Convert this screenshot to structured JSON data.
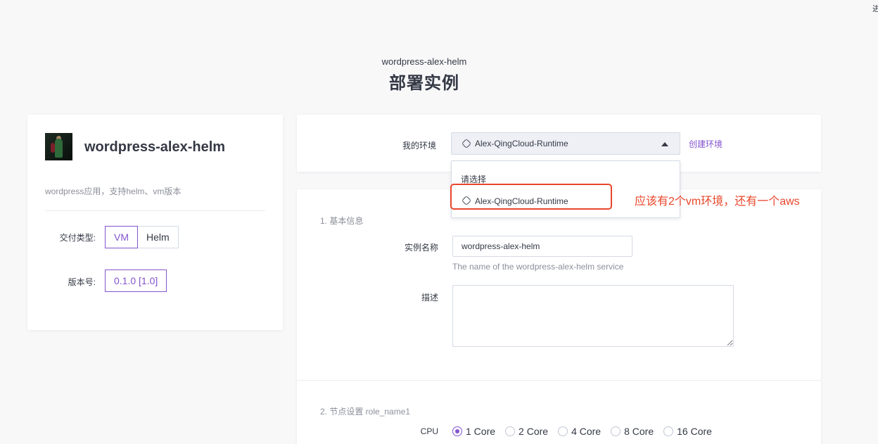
{
  "corner_glyph": "进",
  "header": {
    "subtitle": "wordpress-alex-helm",
    "title": "部署实例"
  },
  "app": {
    "name": "wordpress-alex-helm",
    "description": "wordpress应用，支持helm、vm版本",
    "delivery_type_label": "交付类型:",
    "delivery_types": [
      "VM",
      "Helm"
    ],
    "delivery_type_selected": "VM",
    "version_label": "版本号:",
    "version": "0.1.0 [1.0]"
  },
  "environment": {
    "label": "我的环境",
    "selected": "Alex-QingCloud-Runtime",
    "create_link": "创建环境",
    "dropdown": {
      "placeholder": "请选择",
      "options": [
        "Alex-QingCloud-Runtime"
      ]
    }
  },
  "basic_info": {
    "section_title": "1. 基本信息",
    "name_label": "实例名称",
    "name_value": "wordpress-alex-helm",
    "name_hint": "The name of the wordpress-alex-helm service",
    "desc_label": "描述",
    "desc_value": ""
  },
  "node_settings": {
    "section_title": "2. 节点设置 role_name1",
    "cpu_label": "CPU",
    "cpu_options": [
      "1 Core",
      "2 Core",
      "4 Core",
      "8 Core",
      "16 Core"
    ],
    "cpu_selected": "1 Core"
  },
  "annotation": {
    "text": "应该有2个vm环境，还有一个aws",
    "color": "#e8462a"
  },
  "colors": {
    "accent": "#8454cd",
    "background": "#f8f8f9"
  }
}
